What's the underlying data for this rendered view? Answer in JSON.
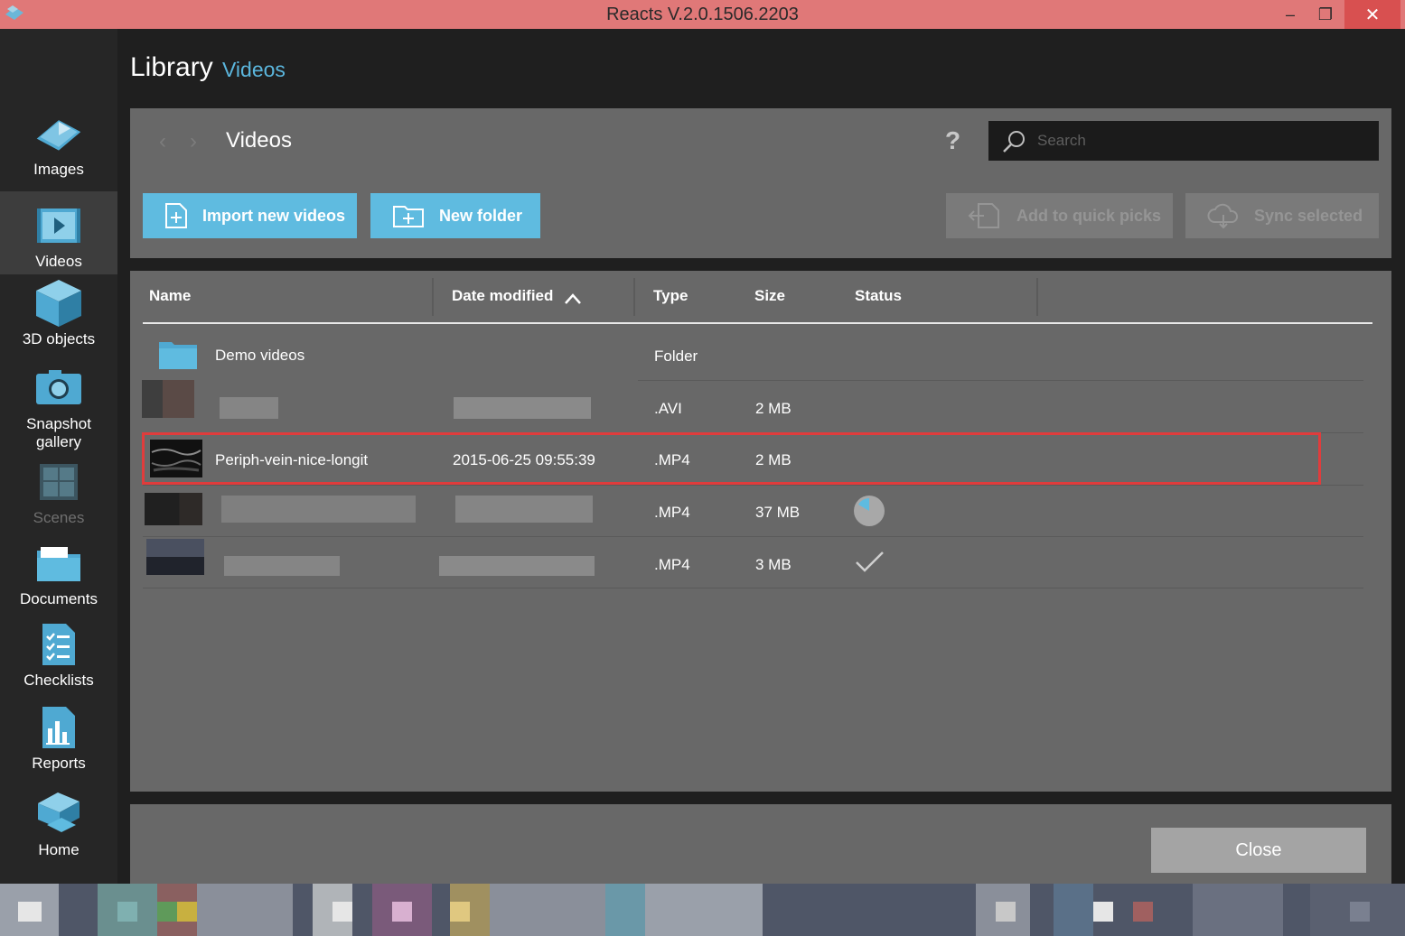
{
  "window": {
    "title": "Reacts V.2.0.1506.2203",
    "min": "–",
    "max": "❐",
    "close": "✕"
  },
  "sidebar": {
    "items": [
      {
        "label": "Images",
        "icon": "images-icon"
      },
      {
        "label": "Videos",
        "icon": "videos-icon",
        "active": true
      },
      {
        "label": "3D objects",
        "icon": "cube-icon"
      },
      {
        "label": "Snapshot gallery",
        "icon": "camera-icon"
      },
      {
        "label": "Scenes",
        "icon": "scenes-icon",
        "disabled": true
      },
      {
        "label": "Documents",
        "icon": "folder-icon"
      },
      {
        "label": "Checklists",
        "icon": "checklist-icon"
      },
      {
        "label": "Reports",
        "icon": "report-icon"
      },
      {
        "label": "Home",
        "icon": "home-icon"
      }
    ]
  },
  "header": {
    "title": "Library",
    "subtitle": "Videos"
  },
  "toolbar": {
    "back": "‹",
    "forward": "›",
    "folder_title": "Videos",
    "help": "?",
    "search_placeholder": "Search",
    "import_label": "Import new videos",
    "new_folder_label": "New folder",
    "quick_picks_label": "Add to quick picks",
    "sync_label": "Sync selected"
  },
  "table": {
    "columns": {
      "name": "Name",
      "date": "Date modified",
      "type": "Type",
      "size": "Size",
      "status": "Status"
    },
    "sort_indicator": "ascending",
    "rows": [
      {
        "name": "Demo videos",
        "date": "",
        "type": "Folder",
        "size": "",
        "status": ""
      },
      {
        "name": "",
        "date": "",
        "type": ".AVI",
        "size": "2 MB",
        "status": ""
      },
      {
        "name": "Periph-vein-nice-longit",
        "date": "2015-06-25 09:55:39",
        "type": ".MP4",
        "size": "2 MB",
        "status": "",
        "selected": true
      },
      {
        "name": "",
        "date": "",
        "type": ".MP4",
        "size": "37 MB",
        "status": "syncing"
      },
      {
        "name": "",
        "date": "",
        "type": ".MP4",
        "size": "3 MB",
        "status": "synced"
      }
    ]
  },
  "footer": {
    "close_label": "Close"
  },
  "colors": {
    "accent": "#5fbbe0",
    "titlebar": "#e07878",
    "selection": "#e03c3c"
  }
}
